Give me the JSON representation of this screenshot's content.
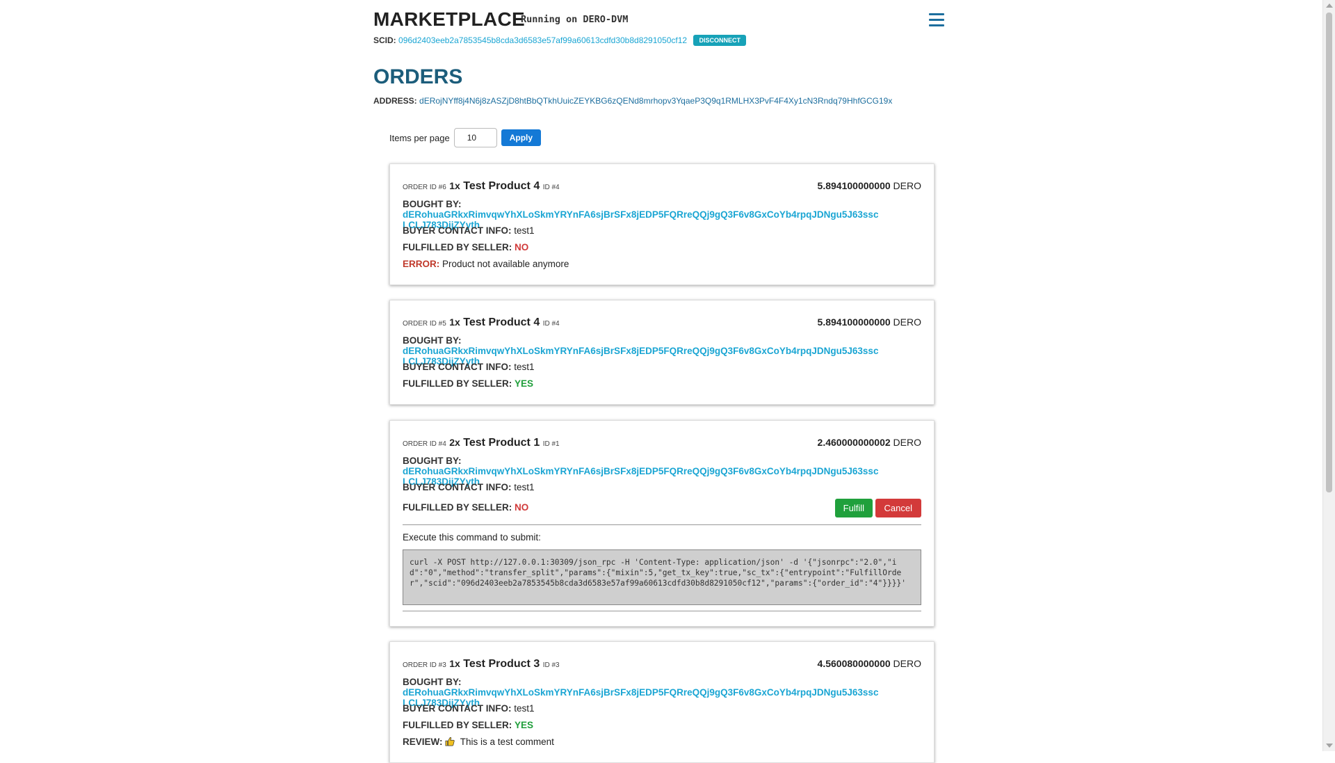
{
  "header": {
    "title": "MARKETPLACE",
    "running": "Running on DERO-DVM",
    "scid_label": "SCID:",
    "scid": "096d2403eeb2a7853545b8cda3d6583e57af99a60613cdfd30b8d8291050cf12",
    "disconnect_label": "DISCONNECT"
  },
  "page": {
    "title": "ORDERS",
    "address_label": "ADDRESS:",
    "address": "dERojNYff8j4N6j8zASZjD8htBbQTkhUuicZEYKBG6zQENd8mrhopv3YqaeP3Q9q1RMLHX3PvF4F4Xy1cN3Rndq79HhfGCG19x"
  },
  "pagination": {
    "label": "Items per page",
    "value": "10",
    "apply_label": "Apply"
  },
  "labels": {
    "order_id": "ORDER ID #",
    "id": "ID #",
    "bought_by": "BOUGHT BY:",
    "contact": "BUYER CONTACT INFO:",
    "fulfilled": "FULFILLED BY SELLER:",
    "error": "ERROR:",
    "review": "REVIEW:",
    "currency": "DERO",
    "execute": "Execute this command to submit:",
    "fulfill": "Fulfill",
    "cancel": "Cancel"
  },
  "orders": [
    {
      "order_id": "6",
      "qty": "1x",
      "product": "Test Product 4",
      "product_id": "4",
      "price": "5.894100000000",
      "buyer_line1": "dERohuaGRkxRimvqwYhXLoSkmYRYnFA6sjBrSFx8jEDP5FQRreQQj9gQ3F6v8GxCoYb4rpqJDNgu5J63ssc",
      "buyer_line2": "LCLJ783DijZYyth",
      "contact": "test1",
      "fulfilled": "NO",
      "error": "Product not available anymore"
    },
    {
      "order_id": "5",
      "qty": "1x",
      "product": "Test Product 4",
      "product_id": "4",
      "price": "5.894100000000",
      "buyer_line1": "dERohuaGRkxRimvqwYhXLoSkmYRYnFA6sjBrSFx8jEDP5FQRreQQj9gQ3F6v8GxCoYb4rpqJDNgu5J63ssc",
      "buyer_line2": "LCLJ783DijZYyth",
      "contact": "test1",
      "fulfilled": "YES"
    },
    {
      "order_id": "4",
      "qty": "2x",
      "product": "Test Product 1",
      "product_id": "1",
      "price": "2.460000000002",
      "buyer_line1": "dERohuaGRkxRimvqwYhXLoSkmYRYnFA6sjBrSFx8jEDP5FQRreQQj9gQ3F6v8GxCoYb4rpqJDNgu5J63ssc",
      "buyer_line2": "LCLJ783DijZYyth",
      "contact": "test1",
      "fulfilled": "NO",
      "command": "curl -X POST http://127.0.0.1:30309/json_rpc -H 'Content-Type: application/json' -d '{\"jsonrpc\":\"2.0\",\"id\":\"0\",\"method\":\"transfer_split\",\"params\":{\"mixin\":5,\"get_tx_key\":true,\"sc_tx\":{\"entrypoint\":\"FulfillOrder\",\"scid\":\"096d2403eeb2a7853545b8cda3d6583e57af99a60613cdfd30b8d8291050cf12\",\"params\":{\"order_id\":\"4\"}}}}'"
    },
    {
      "order_id": "3",
      "qty": "1x",
      "product": "Test Product 3",
      "product_id": "3",
      "price": "4.560080000000",
      "buyer_line1": "dERohuaGRkxRimvqwYhXLoSkmYRYnFA6sjBrSFx8jEDP5FQRreQQj9gQ3F6v8GxCoYb4rpqJDNgu5J63ssc",
      "buyer_line2": "LCLJ783DijZYyth",
      "contact": "test1",
      "fulfilled": "YES",
      "review": "This is a test comment"
    }
  ],
  "colors": {
    "link": "#1aa5d3",
    "no": "#d13a3a",
    "yes": "#1f9e3a",
    "apply": "#1479d6",
    "disconnect": "#17a2b8"
  },
  "icons": {
    "menu": "hamburger-icon",
    "review": "thumbs-up-icon"
  }
}
